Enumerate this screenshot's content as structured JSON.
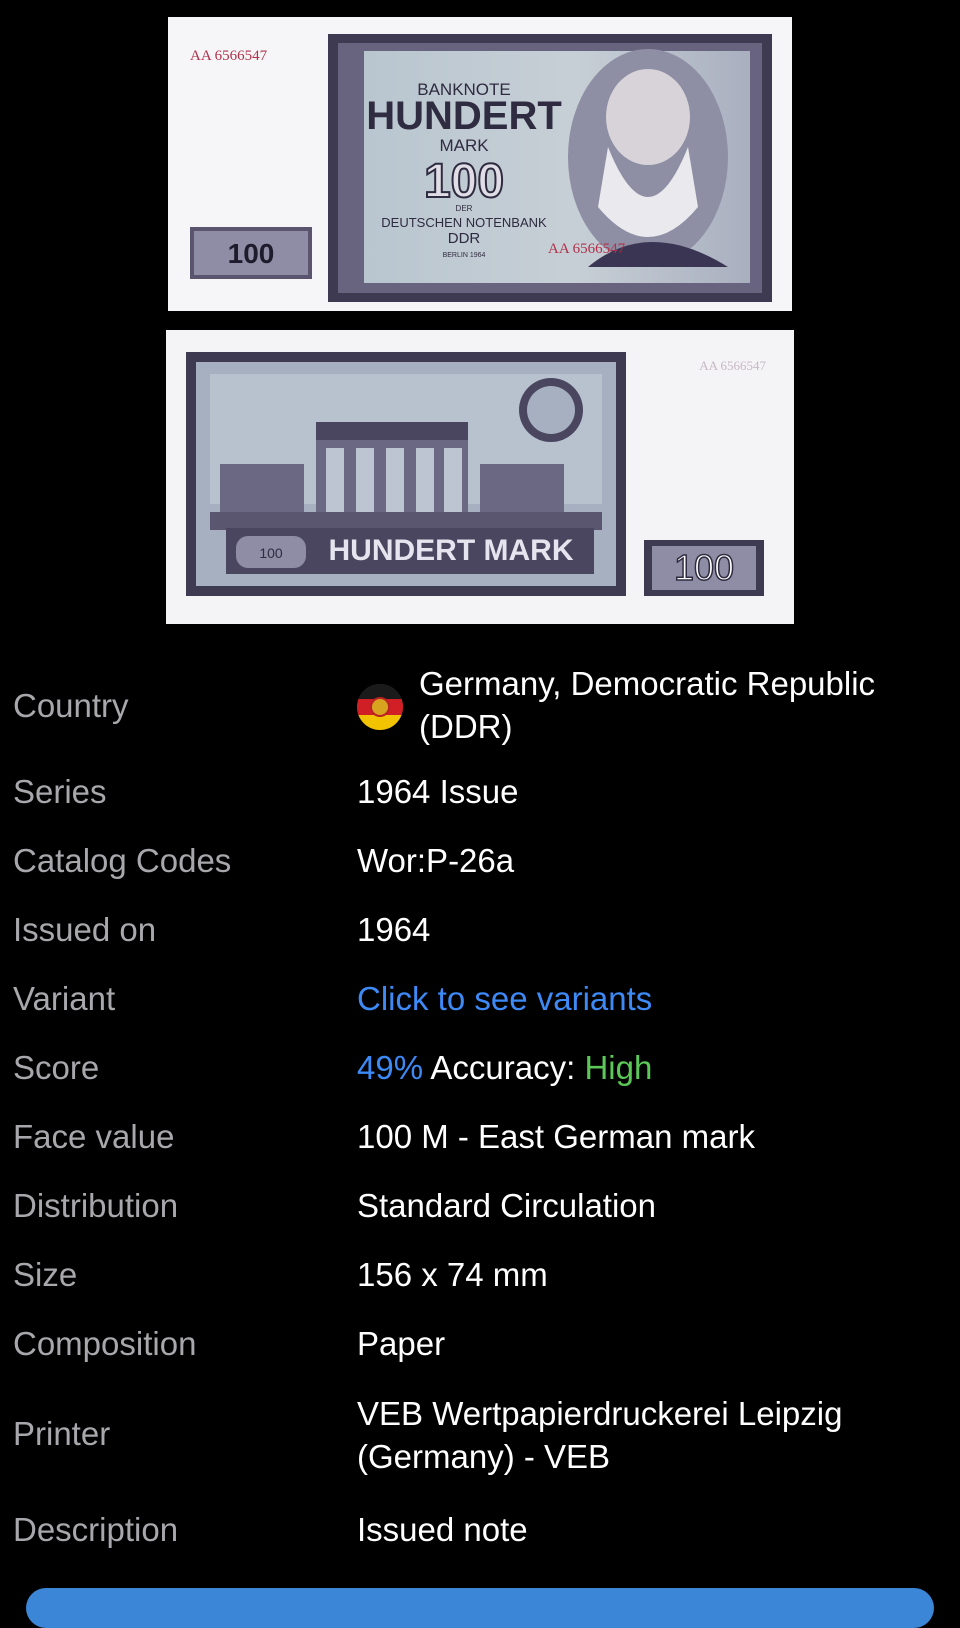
{
  "banknote_front": {
    "serial_top": "AA 6566547",
    "serial_bottom": "AA 6566547",
    "heading": "BANKNOTE",
    "denomination_word": "HUNDERT",
    "currency_word": "MARK",
    "denomination_number": "100",
    "issuer_line1": "DER",
    "issuer_line2": "DEUTSCHEN NOTENBANK",
    "issuer_line3": "DDR",
    "issuer_line4": "BERLIN 1964",
    "corner_value": "100"
  },
  "banknote_back": {
    "serial": "AA 6566547",
    "title": "HUNDERT MARK",
    "corner_value": "100",
    "small_value": "100"
  },
  "details": {
    "country": {
      "label": "Country",
      "value_line1": "Germany, Democratic Republic",
      "value_line2": "(DDR)",
      "flag_icon": "ddr-flag-icon"
    },
    "series": {
      "label": "Series",
      "value": "1964 Issue"
    },
    "catalog_codes": {
      "label": "Catalog Codes",
      "value": "Wor:P-26a"
    },
    "issued_on": {
      "label": "Issued on",
      "value": "1964"
    },
    "variant": {
      "label": "Variant",
      "value": "Click to see variants"
    },
    "score": {
      "label": "Score",
      "percent": "49%",
      "accuracy_label": "Accuracy:",
      "accuracy_value": "High"
    },
    "face_value": {
      "label": "Face value",
      "value": "100 M - East German mark"
    },
    "distribution": {
      "label": "Distribution",
      "value": "Standard Circulation"
    },
    "size": {
      "label": "Size",
      "value": "156 x 74 mm"
    },
    "composition": {
      "label": "Composition",
      "value": "Paper"
    },
    "printer": {
      "label": "Printer",
      "value_line1": "VEB Wertpapierdruckerei Leipzig",
      "value_line2": "(Germany) - VEB"
    },
    "description": {
      "label": "Description",
      "value": "Issued note"
    }
  },
  "colors": {
    "background": "#000000",
    "label": "#a7a7ac",
    "value": "#ffffff",
    "link": "#3d8af7",
    "accuracy_high": "#5cc857",
    "button": "#3b86d6"
  }
}
